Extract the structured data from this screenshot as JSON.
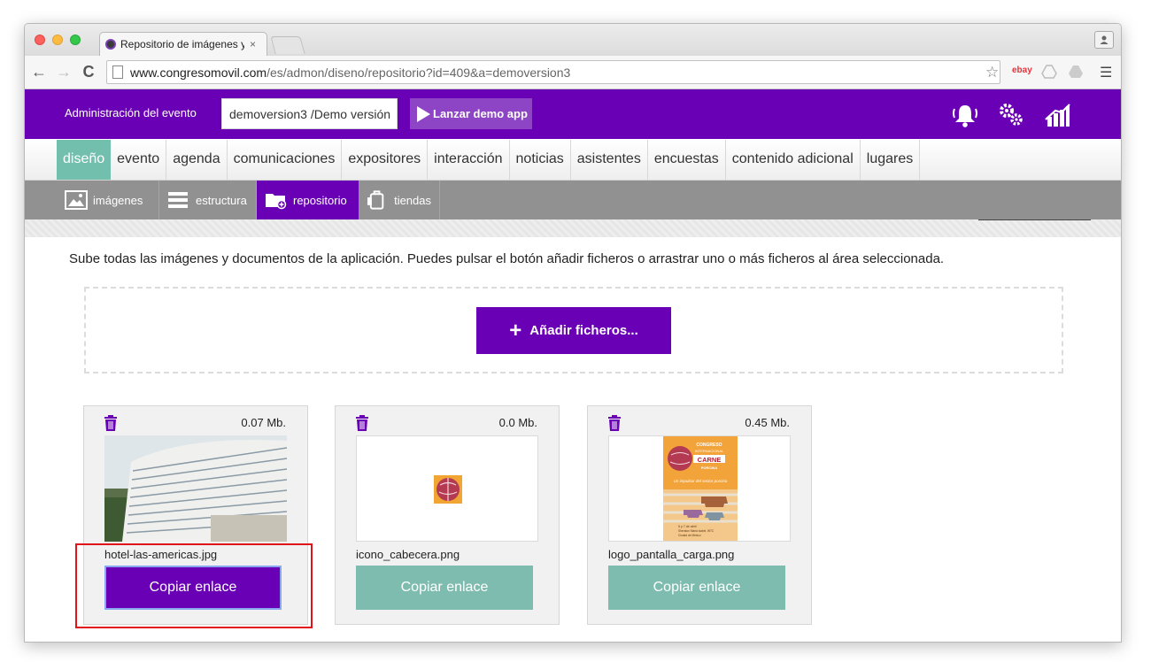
{
  "browser": {
    "tab_title": "Repositorio de imágenes y",
    "tab_close": "×",
    "url_host": "www.congresomovil.com",
    "url_path": "/es/admon/diseno/repositorio?id=409&a=demoversion3",
    "extension_ebay": "ebay"
  },
  "header": {
    "admin_label": "Administración del evento",
    "event_select": "demoversion3 /Demo versión",
    "launch_label": "Lanzar demo app",
    "color": "#6a00b5"
  },
  "mainnav": {
    "items": [
      {
        "label": "diseño"
      },
      {
        "label": "evento"
      },
      {
        "label": "agenda"
      },
      {
        "label": "comunicaciones"
      },
      {
        "label": "expositores"
      },
      {
        "label": "interacción"
      },
      {
        "label": "noticias"
      },
      {
        "label": "asistentes"
      },
      {
        "label": "encuestas"
      },
      {
        "label": "contenido adicional"
      },
      {
        "label": "lugares"
      }
    ],
    "active": "diseño",
    "active_color": "#73bfae"
  },
  "subnav": {
    "items": [
      {
        "label": "imágenes",
        "icon": "image-icon"
      },
      {
        "label": "estructura",
        "icon": "list-icon"
      },
      {
        "label": "repositorio",
        "icon": "folder-icon"
      },
      {
        "label": "tiendas",
        "icon": "store-icon"
      }
    ],
    "active": "repositorio"
  },
  "content": {
    "intro": "Sube todas las imágenes y documentos de la aplicación. Puedes pulsar el botón añadir ficheros o arrastrar uno o más ficheros al área seleccionada.",
    "add_button": "Añadir ficheros...",
    "add_icon": "+",
    "files": [
      {
        "name": "hotel-las-americas.jpg",
        "size": "0.07 Mb.",
        "copy_label": "Copiar enlace"
      },
      {
        "name": "icono_cabecera.png",
        "size": "0.0 Mb.",
        "copy_label": "Copiar enlace"
      },
      {
        "name": "logo_pantalla_carga.png",
        "size": "0.45 Mb.",
        "copy_label": "Copiar enlace"
      }
    ]
  },
  "poster": {
    "line1": "CONGRESO",
    "line2": "INTERNACIONAL",
    "line3": "CARNE",
    "line4": "PORCINA",
    "tagline": "Un impulsor del sector porcino",
    "date1": "5 y 7 de abril",
    "date2": "Sheraton Maria Isabel, WTC",
    "date3": "Ciudad de México"
  }
}
